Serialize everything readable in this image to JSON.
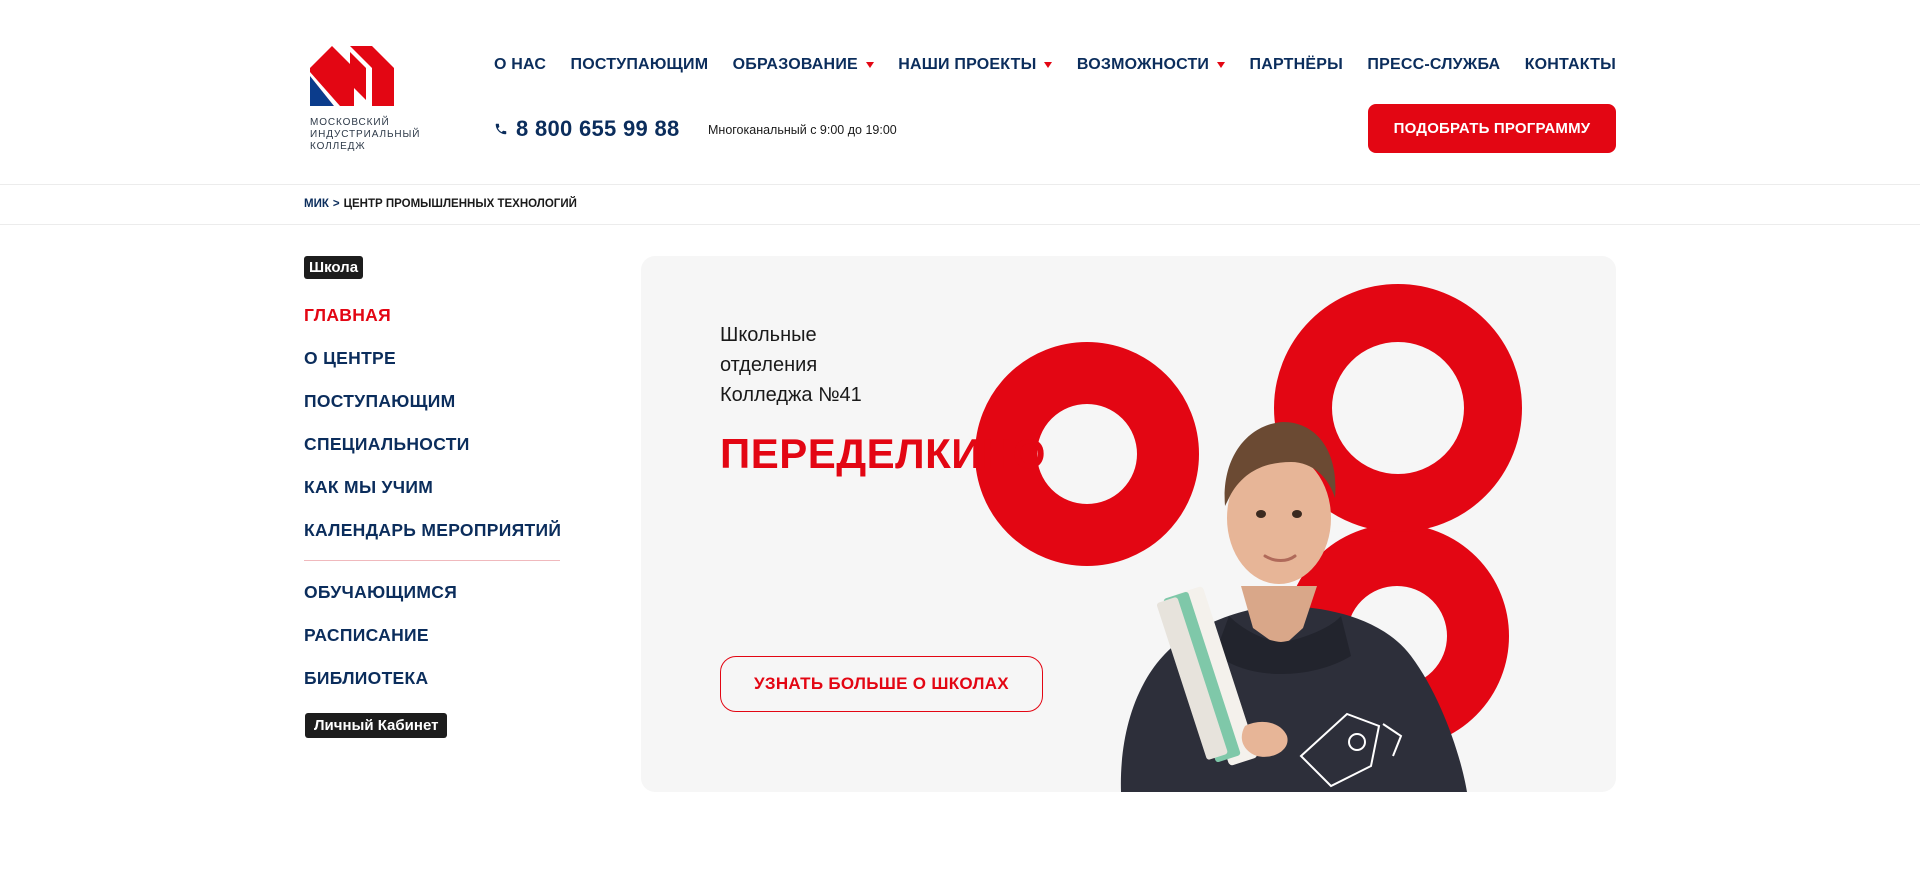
{
  "logo": {
    "lines": [
      "МОСКОВСКИЙ",
      "ИНДУСТРИАЛЬНЫЙ",
      "КОЛЛЕДЖ"
    ],
    "colors": {
      "red": "#e30613",
      "blue": "#0b3c8c"
    }
  },
  "nav": {
    "items": [
      {
        "label": "О НАС",
        "dropdown": false
      },
      {
        "label": "ПОСТУПАЮЩИМ",
        "dropdown": false
      },
      {
        "label": "ОБРАЗОВАНИЕ",
        "dropdown": true
      },
      {
        "label": "НАШИ ПРОЕКТЫ",
        "dropdown": true
      },
      {
        "label": "ВОЗМОЖНОСТИ",
        "dropdown": true
      },
      {
        "label": "ПАРТНЁРЫ",
        "dropdown": false
      },
      {
        "label": "ПРЕСС-СЛУЖБА",
        "dropdown": false
      },
      {
        "label": "КОНТАКТЫ",
        "dropdown": false
      }
    ]
  },
  "contact": {
    "phone": "8 800 655 99 88",
    "hours": "Многоканальный с 9:00 до 19:00",
    "icon": "phone-icon"
  },
  "header": {
    "cta_label": "ПОДОБРАТЬ ПРОГРАММУ"
  },
  "breadcrumb": {
    "home": "МИК",
    "separator": ">",
    "current": "ЦЕНТР ПРОМЫШЛЕННЫХ ТЕХНОЛОГИЙ"
  },
  "sidebar": {
    "badge": "Школа",
    "items": [
      {
        "label": "ГЛАВНАЯ",
        "active": true
      },
      {
        "label": "О ЦЕНТРЕ",
        "active": false
      },
      {
        "label": "ПОСТУПАЮЩИМ",
        "active": false
      },
      {
        "label": "СПЕЦИАЛЬНОСТИ",
        "active": false
      },
      {
        "label": "КАК МЫ УЧИМ",
        "active": false
      },
      {
        "label": "КАЛЕНДАРЬ МЕРОПРИЯТИЙ",
        "active": false
      }
    ],
    "items2": [
      {
        "label": "ОБУЧАЮЩИМСЯ"
      },
      {
        "label": "РАСПИСАНИЕ"
      },
      {
        "label": "БИБЛИОТЕКА"
      }
    ],
    "cabinet": "Личный Кабинет"
  },
  "hero": {
    "subtitle": [
      "Школьные",
      "отделения",
      "Колледжа №41"
    ],
    "title": "ПЕРЕДЕЛКИНО",
    "button": "УЗНАТЬ БОЛЬШЕ О ШКОЛАХ",
    "accent": "#e30613"
  }
}
